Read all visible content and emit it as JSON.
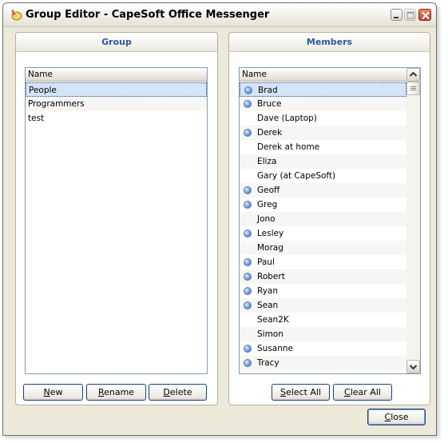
{
  "window": {
    "title": "Group Editor - CapeSoft Office Messenger",
    "icon": "messenger-app-icon"
  },
  "group_panel": {
    "heading": "Group",
    "column_header": "Name",
    "items": [
      {
        "label": "People",
        "selected": true
      },
      {
        "label": "Programmers",
        "selected": false
      },
      {
        "label": "test",
        "selected": false
      }
    ],
    "buttons": {
      "new_mnemonic": "N",
      "new_rest": "ew",
      "rename_mnemonic": "R",
      "rename_rest": "ename",
      "delete_mnemonic": "D",
      "delete_rest": "elete"
    }
  },
  "members_panel": {
    "heading": "Members",
    "column_header": "Name",
    "items": [
      {
        "label": "Brad",
        "online": true,
        "selected": true
      },
      {
        "label": "Bruce",
        "online": true,
        "selected": false
      },
      {
        "label": "Dave (Laptop)",
        "online": false,
        "selected": false
      },
      {
        "label": "Derek",
        "online": true,
        "selected": false
      },
      {
        "label": "Derek at home",
        "online": false,
        "selected": false
      },
      {
        "label": "Eliza",
        "online": false,
        "selected": false
      },
      {
        "label": "Gary (at CapeSoft)",
        "online": false,
        "selected": false
      },
      {
        "label": "Geoff",
        "online": true,
        "selected": false
      },
      {
        "label": "Greg",
        "online": true,
        "selected": false
      },
      {
        "label": "Jono",
        "online": false,
        "selected": false
      },
      {
        "label": "Lesley",
        "online": true,
        "selected": false
      },
      {
        "label": "Morag",
        "online": false,
        "selected": false
      },
      {
        "label": "Paul",
        "online": true,
        "selected": false
      },
      {
        "label": "Robert",
        "online": true,
        "selected": false
      },
      {
        "label": "Ryan",
        "online": true,
        "selected": false
      },
      {
        "label": "Sean",
        "online": true,
        "selected": false
      },
      {
        "label": "Sean2K",
        "online": false,
        "selected": false
      },
      {
        "label": "Simon",
        "online": false,
        "selected": false
      },
      {
        "label": "Susanne",
        "online": true,
        "selected": false
      },
      {
        "label": "Tracy",
        "online": true,
        "selected": false
      }
    ],
    "buttons": {
      "select_all_pre": "",
      "select_all_mnemonic": "S",
      "select_all_rest": "elect All",
      "clear_all_mnemonic": "C",
      "clear_all_rest": "lear All"
    }
  },
  "footer": {
    "close_mnemonic": "C",
    "close_rest": "lose"
  },
  "colors": {
    "panel_heading": "#2e58a0",
    "selection": "#d5e5f9",
    "online_dot": "#3b6cc0"
  }
}
